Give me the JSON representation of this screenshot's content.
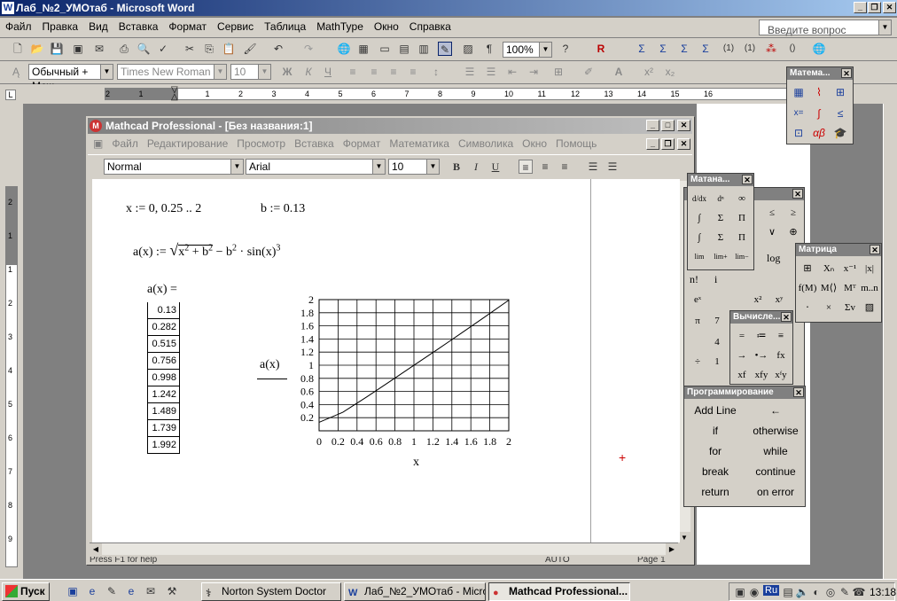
{
  "word": {
    "title": "Лаб_№2_УМОтаб - Microsoft Word",
    "menu": [
      "Файл",
      "Правка",
      "Вид",
      "Вставка",
      "Формат",
      "Сервис",
      "Таблица",
      "MathType",
      "Окно",
      "Справка"
    ],
    "help_placeholder": "Введите вопрос",
    "zoom": "100%",
    "style": "Обычный + Меж",
    "font": "Times New Roman",
    "font_size": "10",
    "ruler_marks": [
      "2",
      "1",
      "1",
      "2",
      "3",
      "4",
      "5",
      "6",
      "7",
      "8",
      "9",
      "10",
      "11",
      "12",
      "13",
      "14",
      "15",
      "16"
    ],
    "vruler_marks": [
      "2",
      "1",
      "1",
      "2",
      "3",
      "4",
      "5",
      "6",
      "7",
      "8",
      "9"
    ]
  },
  "mathcad": {
    "title": "Mathcad Professional - [Без названия:1]",
    "menu": [
      "Файл",
      "Редактирование",
      "Просмотр",
      "Вставка",
      "Формат",
      "Математика",
      "Символика",
      "Окно",
      "Помощь"
    ],
    "style": "Normal",
    "font": "Arial",
    "font_size": "10",
    "status_left": "Press F1 for help",
    "status_auto": "AUTO",
    "status_page": "Page 1",
    "expr_range": "x := 0, 0.25 .. 2",
    "expr_b": "b := 0.13",
    "expr_func_lhs": "a(x) := ",
    "expr_func_rhs_a": "x",
    "expr_func_rhs_b": "2",
    "expr_func_rhs_c": " + b",
    "expr_func_rhs_d": "2",
    "expr_func_rhs_e": " − b",
    "expr_func_rhs_f": "2",
    "expr_func_rhs_g": " · sin(x)",
    "expr_func_rhs_h": "3",
    "eval_label": "a(x) =",
    "table_values": [
      "0.13",
      "0.282",
      "0.515",
      "0.756",
      "0.998",
      "1.242",
      "1.489",
      "1.739",
      "1.992"
    ],
    "plot_ylabel": "a(x)",
    "plot_xlabel": "x"
  },
  "chart_data": {
    "type": "line",
    "x": [
      0,
      0.25,
      0.5,
      0.75,
      1,
      1.25,
      1.5,
      1.75,
      2
    ],
    "series": [
      {
        "values": [
          0.13,
          0.282,
          0.515,
          0.756,
          0.998,
          1.242,
          1.489,
          1.739,
          1.992
        ]
      }
    ],
    "xlabel": "x",
    "ylabel": "a(x)",
    "xlim": [
      0,
      2
    ],
    "ylim": [
      0,
      2
    ],
    "xticks": [
      "0",
      "0.2",
      "0.4",
      "0.6",
      "0.8",
      "1",
      "1.2",
      "1.4",
      "1.6",
      "1.8",
      "2"
    ],
    "yticks": [
      "0.2",
      "0.4",
      "0.6",
      "0.8",
      "1",
      "1.2",
      "1.4",
      "1.6",
      "1.8",
      "2"
    ],
    "grid": true
  },
  "palettes": {
    "math_title": "Матема...",
    "matan_title": "Матана...",
    "matrix_title": "Матрица",
    "eval_title": "Вычисле...",
    "prog_title": "Программирование",
    "prog_items": [
      "Add Line",
      "←",
      "if",
      "otherwise",
      "for",
      "while",
      "break",
      "continue",
      "return",
      "on error"
    ],
    "matrix_items": [
      "|x|",
      "log",
      "n!",
      "i",
      "x⁻¹",
      "|x|",
      "f(M)",
      "M⟨⟩",
      "Mᵀ",
      "m..n"
    ],
    "eval_items": [
      "=",
      "≔",
      "≡",
      "→",
      "•→",
      "fx",
      "xf",
      "xfy",
      "xᶠy"
    ],
    "calc_items": [
      "≤",
      "≥",
      "∨",
      "⊕",
      "eˣ",
      "x²",
      "xʸ",
      "π",
      "7",
      "4",
      "1",
      "÷"
    ]
  },
  "taskbar": {
    "start": "Пуск",
    "tasks": [
      "Norton System Doctor",
      "Лаб_№2_УМОтаб - Micro...",
      "Mathcad Professional..."
    ],
    "clock": "13:18",
    "lang": "Ru"
  }
}
